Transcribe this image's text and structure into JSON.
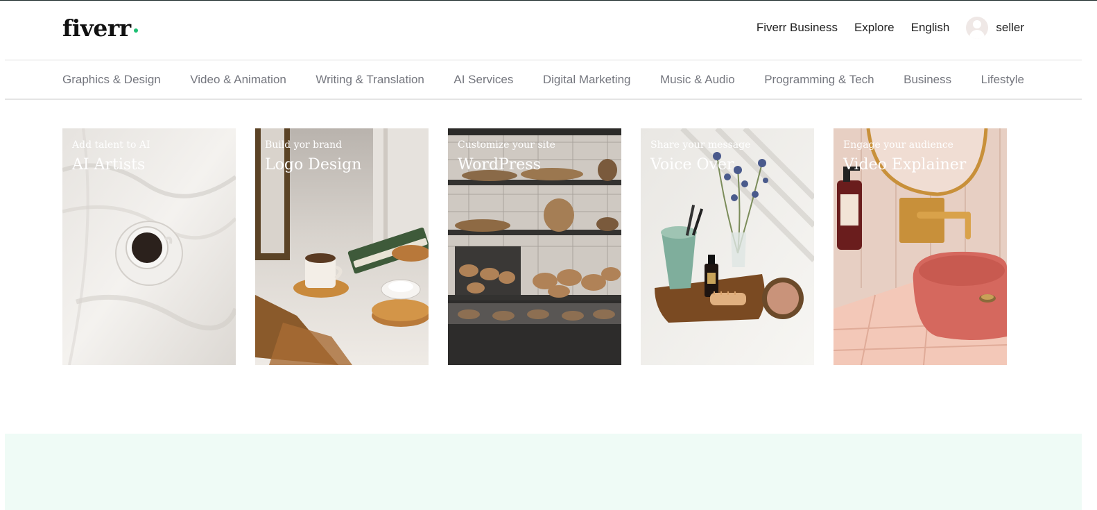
{
  "brand": {
    "name": "fiverr",
    "dot_color": "#1dbf73"
  },
  "topnav": {
    "links": [
      "Fiverr Business",
      "Explore",
      "English"
    ],
    "user": {
      "avatar_icon": "user-avatar-icon",
      "name": "seller"
    }
  },
  "categories": [
    "Graphics & Design",
    "Video & Animation",
    "Writing & Translation",
    "AI Services",
    "Digital Marketing",
    "Music & Audio",
    "Programming & Tech",
    "Business",
    "Lifestyle"
  ],
  "cards": [
    {
      "subtitle": "Add talent to AI",
      "title": "AI Artists"
    },
    {
      "subtitle": "Build yor brand",
      "title": "Logo Design"
    },
    {
      "subtitle": "Customize your site",
      "title": "WordPress"
    },
    {
      "subtitle": "Share your message",
      "title": "Voice Over"
    },
    {
      "subtitle": "Engage your audience",
      "title": "Video Explainer"
    }
  ],
  "colors": {
    "accent": "#1dbf73",
    "category_text": "#74767e",
    "section_bg": "#effbf6"
  }
}
